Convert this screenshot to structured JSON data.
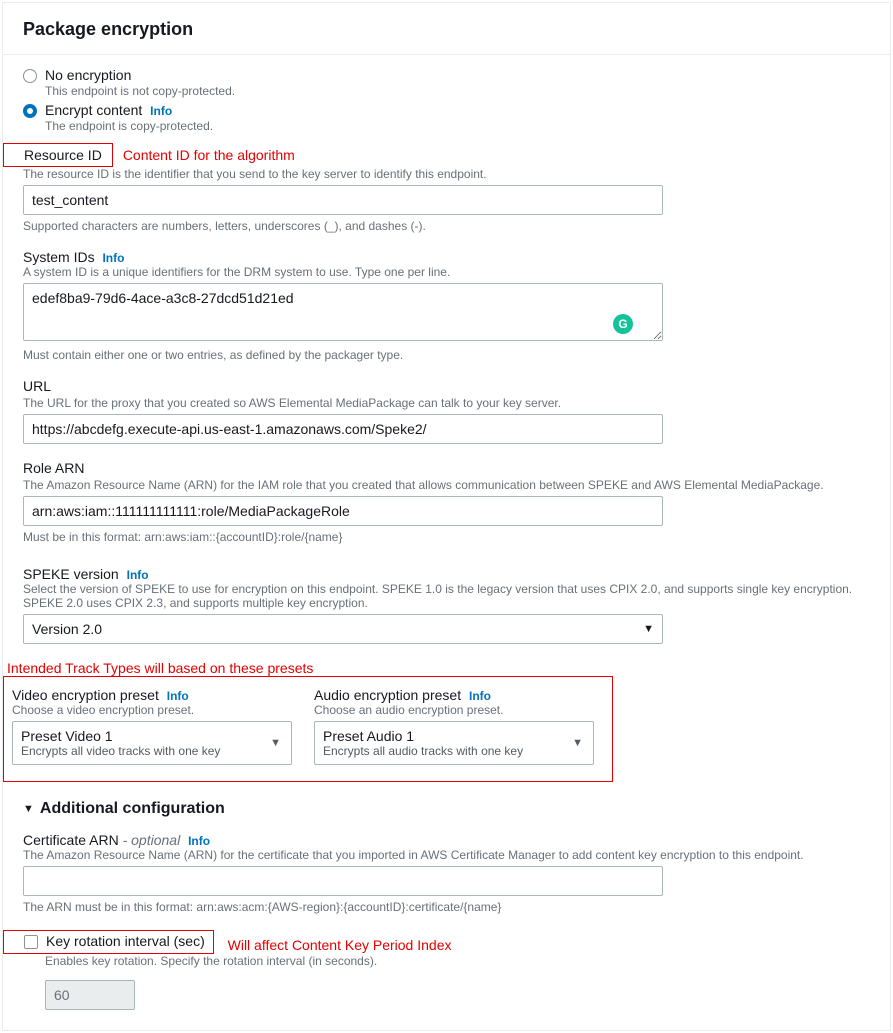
{
  "header": {
    "title": "Package encryption"
  },
  "radios": {
    "no_enc": {
      "title": "No encryption",
      "desc": "This endpoint is not copy-protected."
    },
    "enc": {
      "title": "Encrypt content",
      "desc": "The endpoint is copy-protected.",
      "info": "Info"
    }
  },
  "annotations": {
    "resource_id": "Content ID for the algorithm",
    "presets": "Intended Track Types will based on these presets",
    "key_rotation": "Will affect Content Key Period Index"
  },
  "resource_id": {
    "label": "Resource ID",
    "desc": "The resource ID is the identifier that you send to the key server to identify this endpoint.",
    "value": "test_content",
    "help": "Supported characters are numbers, letters, underscores (_), and dashes (-)."
  },
  "system_ids": {
    "label": "System IDs",
    "info": "Info",
    "desc": "A system ID is a unique identifiers for the DRM system to use. Type one per line.",
    "value": "edef8ba9-79d6-4ace-a3c8-27dcd51d21ed",
    "help": "Must contain either one or two entries, as defined by the packager type."
  },
  "url": {
    "label": "URL",
    "desc": "The URL for the proxy that you created so AWS Elemental MediaPackage can talk to your key server.",
    "value": "https://abcdefg.execute-api.us-east-1.amazonaws.com/Speke2/"
  },
  "role_arn": {
    "label": "Role ARN",
    "desc": "The Amazon Resource Name (ARN) for the IAM role that you created that allows communication between SPEKE and AWS Elemental MediaPackage.",
    "value": "arn:aws:iam::111111111111:role/MediaPackageRole",
    "help": "Must be in this format: arn:aws:iam::{accountID}:role/{name}"
  },
  "speke": {
    "label": "SPEKE version",
    "info": "Info",
    "desc": "Select the version of SPEKE to use for encryption on this endpoint. SPEKE 1.0 is the legacy version that uses CPIX 2.0, and supports single key encryption. SPEKE 2.0 uses CPIX 2.3, and supports multiple key encryption.",
    "value": "Version 2.0"
  },
  "video_preset": {
    "label": "Video encryption preset",
    "info": "Info",
    "desc": "Choose a video encryption preset.",
    "value": "Preset Video 1",
    "sub": "Encrypts all video tracks with one key"
  },
  "audio_preset": {
    "label": "Audio encryption preset",
    "info": "Info",
    "desc": "Choose an audio encryption preset.",
    "value": "Preset Audio 1",
    "sub": "Encrypts all audio tracks with one key"
  },
  "additional": {
    "title": "Additional configuration"
  },
  "cert_arn": {
    "label": "Certificate ARN",
    "optional": "- optional",
    "info": "Info",
    "desc": "The Amazon Resource Name (ARN) for the certificate that you imported in AWS Certificate Manager to add content key encryption to this endpoint.",
    "help": "The ARN must be in this format: arn:aws:acm:{AWS-region}:{accountID}:certificate/{name}"
  },
  "key_rotation": {
    "label": "Key rotation interval (sec)",
    "desc": "Enables key rotation. Specify the rotation interval (in seconds).",
    "value": "60"
  }
}
